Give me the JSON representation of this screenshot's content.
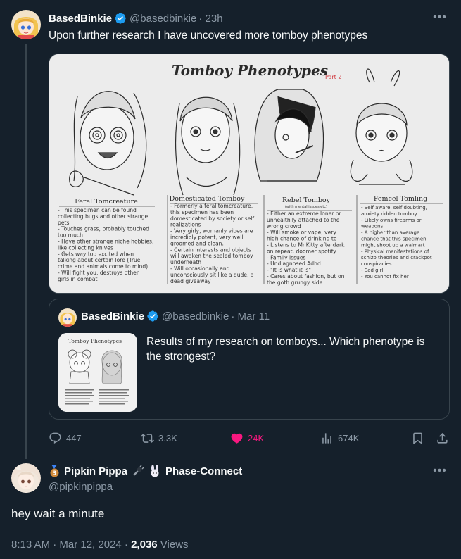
{
  "tweet": {
    "author_name": "BasedBinkie",
    "author_handle": "@basedbinkie",
    "time": "· 23h",
    "text": "Upon further research I have uncovered more tomboy phenotypes",
    "more_icon": "more-horizontal-icon"
  },
  "media": {
    "title": "Tomboy Phenotypes",
    "part": "Part 2",
    "columns": [
      {
        "name": "Feral Tomcreature",
        "lines": [
          "- This specimen can be found",
          "collecting bugs and other strange",
          "pets",
          "- Touches grass, probably touched",
          "too much",
          "- Have other strange niche hobbies,",
          "like collecting knives",
          "- Gets way too excited when",
          "talking about certain lore (True",
          "crime and animals come to mind)",
          "- Will fight you, destroys other",
          "girls in combat"
        ]
      },
      {
        "name": "Domesticated Tomboy",
        "lines": [
          "- Formerly a feral tomcreature,",
          "this specimen has been",
          "domesticated by society or self",
          "realizations",
          "- Very girly, womanly vibes are",
          "incredibly potent, very well",
          "groomed and clean.",
          "- Certain interests and objects",
          "will awaken the sealed tomboy",
          "underneath",
          "- Will occasionally and",
          "unconsciously sit like a dude, a",
          "dead giveaway"
        ]
      },
      {
        "name": "Rebel Tomboy",
        "subtitle": "(with mental issues etc)",
        "lines": [
          "- Either an extreme loner or",
          "unhealthily attached to the",
          "wrong crowd",
          "- Will smoke or vape, very",
          "high chance of drinking to",
          "- Listens to Mr.Kitty afterdark",
          "on repeat, doomer spotify",
          "- Family issues",
          "- Undiagnosed Adhd",
          "- \"It is what it is\"",
          "- Cares about fashion, but on",
          "the goth grungy side"
        ]
      },
      {
        "name": "Femcel Tomling",
        "lines": [
          "- Self aware, self doubting,",
          "anxiety ridden tomboy",
          "- Likely owns firearms or",
          "weapons",
          "- A higher than average",
          "chance that this specimen",
          "might shoot up a walmart",
          "- Physical manifestations of",
          "schizo theories and crackpot",
          "conspiracies",
          "- Sad girl",
          "- You cannot fix her"
        ]
      }
    ]
  },
  "quote": {
    "author_name": "BasedBinkie",
    "author_handle": "@basedbinkie",
    "time": "· Mar 11",
    "text": "Results of my research on tomboys... Which phenotype is the strongest?",
    "thumb_title": "Tomboy Phenotypes"
  },
  "actions": {
    "replies": "447",
    "retweets": "3.3K",
    "likes": "24K",
    "views": "674K",
    "like_color": "#f91880"
  },
  "reply": {
    "author_name": "Pipkin Pippa",
    "affiliation": "Phase-Connect",
    "author_handle": "@pipkinpippa",
    "text": "hey wait a minute",
    "timestamp": "8:13 AM · Mar 12, 2024 · ",
    "views_count": "2,036",
    "views_label": " Views"
  },
  "colors": {
    "background": "#15202b",
    "border": "#38444d",
    "text_secondary": "#8b98a5",
    "verified": "#1d9bf0"
  }
}
